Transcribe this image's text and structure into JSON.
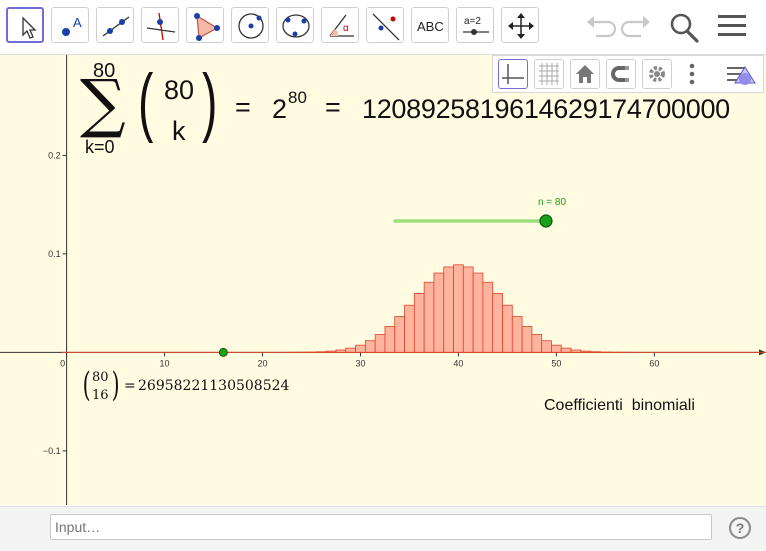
{
  "toolbar": {
    "tools": [
      {
        "name": "move-tool"
      },
      {
        "name": "point-tool",
        "glyph": "A"
      },
      {
        "name": "line-tool"
      },
      {
        "name": "perpendicular-line-tool"
      },
      {
        "name": "polygon-tool"
      },
      {
        "name": "circle-tool"
      },
      {
        "name": "conic-tool"
      },
      {
        "name": "angle-tool",
        "glyph": "α"
      },
      {
        "name": "reflect-tool"
      },
      {
        "name": "text-tool",
        "glyph": "ABC"
      },
      {
        "name": "slider-tool",
        "glyph": "a=2"
      },
      {
        "name": "move-graphics-view-tool"
      }
    ]
  },
  "formula": {
    "sum_upper": "80",
    "sum_lower": "k=0",
    "binom_top": "80",
    "binom_bottom": "k",
    "equals1": "=",
    "power_base": "2",
    "power_exp": "80",
    "equals2": "=",
    "result": "1208925819614629174700000"
  },
  "slider": {
    "label": "n = 80",
    "value": 80
  },
  "point_k": {
    "value": 16
  },
  "binom_result": {
    "top": "80",
    "bottom": "16",
    "equals": "=",
    "value": "26958221130508524"
  },
  "caption": "Coefficienti  binomiali",
  "axes": {
    "x_ticks": [
      "0",
      "10",
      "20",
      "30",
      "40",
      "50",
      "60"
    ],
    "y_ticks": [
      "0.2",
      "0.1",
      "−0.1"
    ],
    "xmin": -6.8,
    "xmax": 71.4,
    "ymin": -0.155,
    "ymax": 0.302
  },
  "input": {
    "placeholder": "Input…"
  },
  "help": {
    "label": "?"
  },
  "colors": {
    "bar_fill": "#ffb4a0",
    "bar_stroke": "#e0442a",
    "slider_line": "#9be07a",
    "slider_point": "#1aa11a",
    "background": "#fffce2"
  },
  "chart_data": {
    "type": "bar",
    "n": 80,
    "x_range": [
      0,
      80
    ],
    "values_note": "binomial probabilities C(80,k)/2^80",
    "highlight_k": 16
  }
}
